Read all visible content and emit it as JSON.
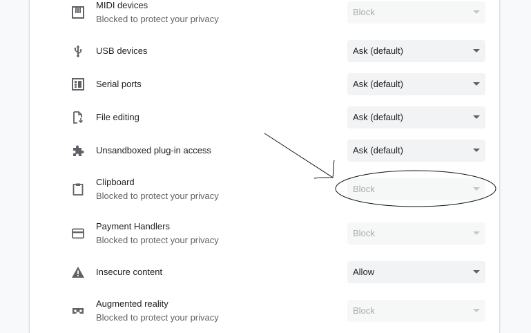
{
  "settings": [
    {
      "title": "MIDI devices",
      "subtitle": "Blocked to protect your privacy",
      "value": "Block",
      "disabled": true,
      "icon": "piano-keys-icon"
    },
    {
      "title": "USB devices",
      "subtitle": "",
      "value": "Ask (default)",
      "disabled": false,
      "icon": "usb-icon"
    },
    {
      "title": "Serial ports",
      "subtitle": "",
      "value": "Ask (default)",
      "disabled": false,
      "icon": "serial-port-icon"
    },
    {
      "title": "File editing",
      "subtitle": "",
      "value": "Ask (default)",
      "disabled": false,
      "icon": "file-edit-icon"
    },
    {
      "title": "Unsandboxed plug-in access",
      "subtitle": "",
      "value": "Ask (default)",
      "disabled": false,
      "icon": "puzzle-piece-icon"
    },
    {
      "title": "Clipboard",
      "subtitle": "Blocked to protect your privacy",
      "value": "Block",
      "disabled": true,
      "icon": "clipboard-icon"
    },
    {
      "title": "Payment Handlers",
      "subtitle": "Blocked to protect your privacy",
      "value": "Block",
      "disabled": true,
      "icon": "credit-card-icon"
    },
    {
      "title": "Insecure content",
      "subtitle": "",
      "value": "Allow",
      "disabled": false,
      "icon": "warning-icon"
    },
    {
      "title": "Augmented reality",
      "subtitle": "Blocked to protect your privacy",
      "value": "Block",
      "disabled": true,
      "icon": "vr-headset-icon"
    }
  ]
}
